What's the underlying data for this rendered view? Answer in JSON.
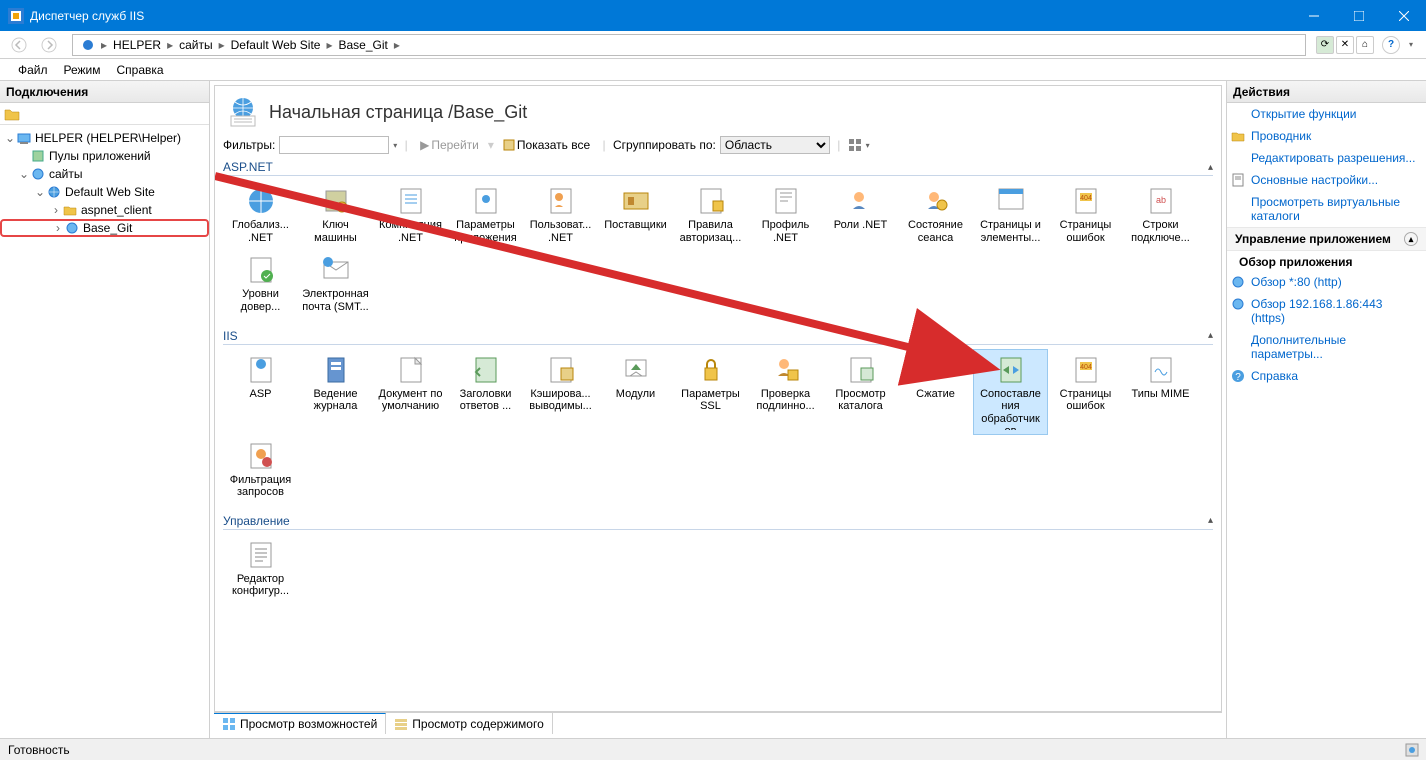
{
  "window": {
    "title": "Диспетчер служб IIS"
  },
  "breadcrumb": [
    "HELPER",
    "сайты",
    "Default Web Site",
    "Base_Git"
  ],
  "menu": {
    "file": "Файл",
    "mode": "Режим",
    "help": "Справка"
  },
  "left": {
    "header": "Подключения",
    "tree": {
      "root": "HELPER (HELPER\\Helper)",
      "app_pools": "Пулы приложений",
      "sites": "сайты",
      "default_site": "Default Web Site",
      "aspnet_client": "aspnet_client",
      "base_git": "Base_Git"
    }
  },
  "page": {
    "title": "Начальная страница /Base_Git",
    "filter_label": "Фильтры:",
    "go": "Перейти",
    "show_all": "Показать все",
    "group_by": "Сгруппировать по:",
    "group_value": "Область"
  },
  "groups": {
    "aspnet": {
      "title": "ASP.NET",
      "items": [
        "Глобализ... .NET",
        "Ключ машины",
        "Компиляция .NET",
        "Параметры приложения",
        "Пользоват... .NET",
        "Поставщики",
        "Правила авторизац...",
        "Профиль .NET",
        "Роли .NET",
        "Состояние сеанса",
        "Страницы и элементы...",
        "Страницы ошибок",
        "Строки подключе...",
        "Уровни довер...",
        "Электронная почта (SMT..."
      ]
    },
    "iis": {
      "title": "IIS",
      "items": [
        "ASP",
        "Ведение журнала",
        "Документ по умолчанию",
        "Заголовки ответов ...",
        "Кэширова... выводимы...",
        "Модули",
        "Параметры SSL",
        "Проверка подлинно...",
        "Просмотр каталога",
        "Сжатие",
        "Сопоставле ния обработчик ов",
        "Страницы ошибок",
        "Типы MIME",
        "Фильтрация запросов"
      ]
    },
    "manage": {
      "title": "Управление",
      "items": [
        "Редактор конфигур..."
      ]
    }
  },
  "center_tabs": {
    "features": "Просмотр возможностей",
    "content": "Просмотр содержимого"
  },
  "right": {
    "header": "Действия",
    "open_feature": "Открытие функции",
    "explorer": "Проводник",
    "edit_perms": "Редактировать разрешения...",
    "basic_settings": "Основные настройки...",
    "view_vdirs": "Просмотреть виртуальные каталоги",
    "app_manage_header": "Управление приложением",
    "app_browse_header": "Обзор приложения",
    "browse_http": "Обзор *:80 (http)",
    "browse_https": "Обзор 192.168.1.86:443 (https)",
    "advanced": "Дополнительные параметры...",
    "help": "Справка"
  },
  "status": {
    "ready": "Готовность"
  }
}
